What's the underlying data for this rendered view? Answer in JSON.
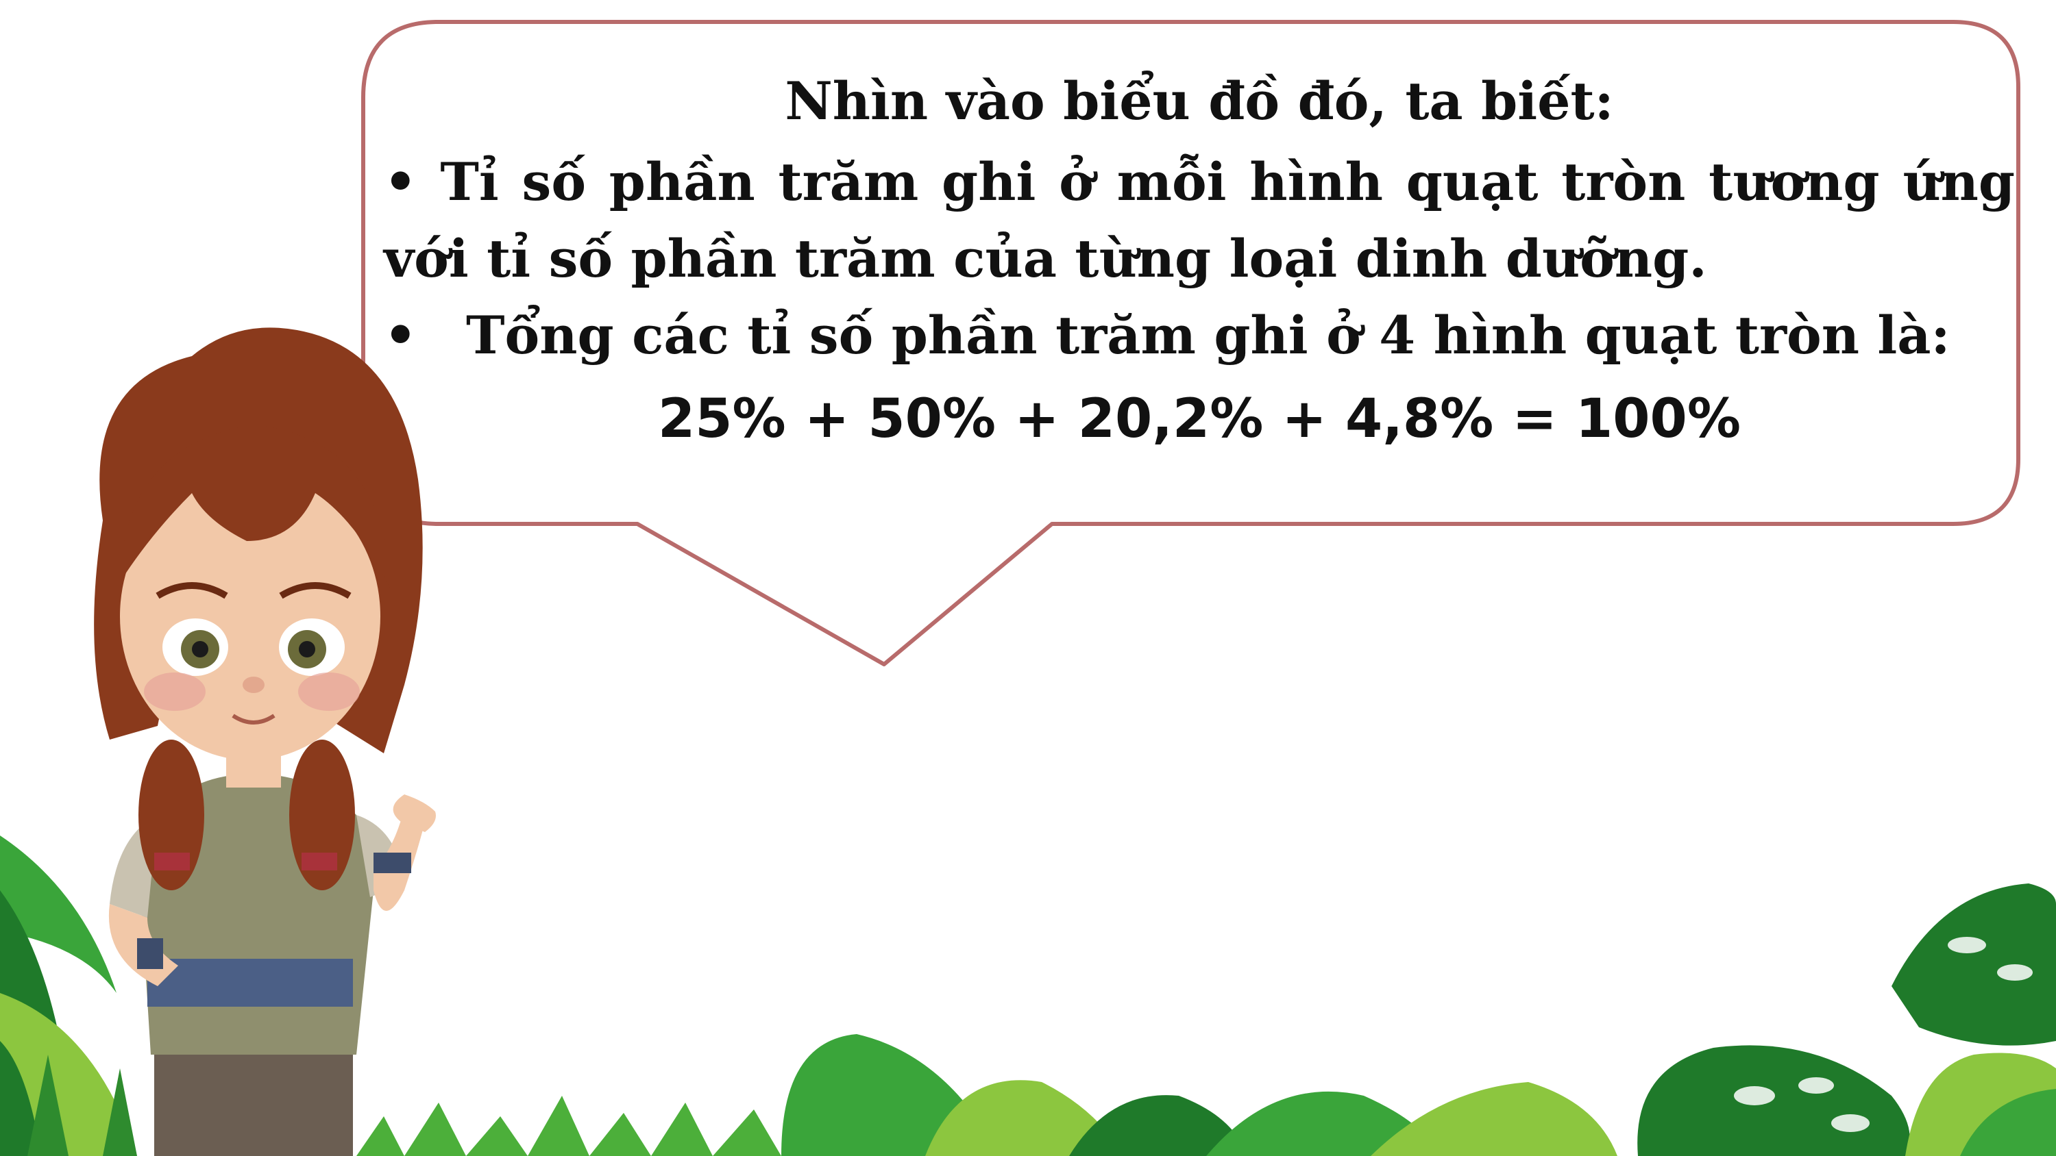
{
  "bubble": {
    "heading": "Nhìn vào biểu đồ đó, ta biết:",
    "bullet_1_marker": "•",
    "bullet_1_text": "Tỉ số phần trăm ghi ở mỗi hình quạt tròn tương ứng với tỉ số phần trăm của từng loại dinh dưỡng.",
    "bullet_2_marker": "•",
    "bullet_2_text": "Tổng các tỉ số phần trăm ghi ở 4 hình quạt tròn là:",
    "formula": "25% + 50% + 20,2% + 4,8% = 100%"
  },
  "colors": {
    "bubble_border": "#b86b6b",
    "text": "#111111",
    "leaf_dark": "#1f7a2a",
    "leaf_mid": "#3aa53a",
    "leaf_light": "#8cc63f",
    "hair": "#8a3a1c",
    "shirt": "#8f8f6e",
    "belt": "#4b5f86"
  },
  "icons": {
    "character": "girl-character-illustration",
    "plants": "jungle-leaves-decoration"
  }
}
